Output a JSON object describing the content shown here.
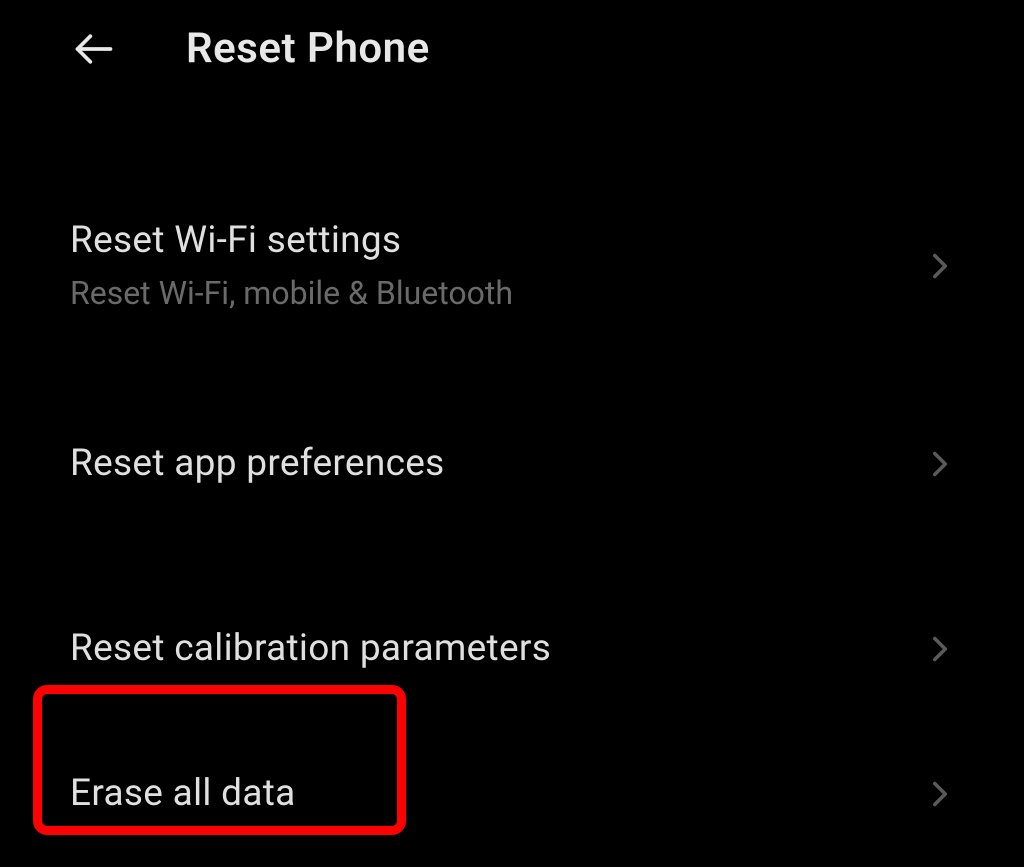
{
  "header": {
    "title": "Reset Phone"
  },
  "items": {
    "wifi": {
      "title": "Reset Wi-Fi settings",
      "subtitle": "Reset Wi-Fi, mobile & Bluetooth"
    },
    "appPrefs": {
      "title": "Reset app preferences"
    },
    "calibration": {
      "title": "Reset calibration parameters"
    },
    "erase": {
      "title": "Erase all data"
    }
  }
}
